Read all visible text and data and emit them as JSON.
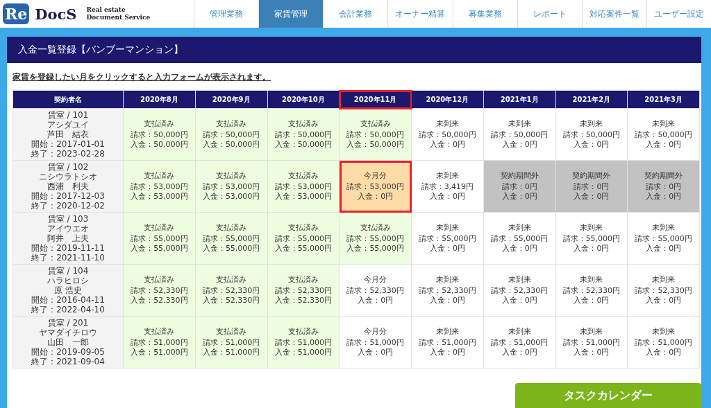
{
  "logo": {
    "mark": "Re",
    "name": "DocS",
    "tagline": [
      "Real estate",
      "Document Service"
    ]
  },
  "nav": [
    {
      "label": "管理業務",
      "selected": false
    },
    {
      "label": "家賃管理",
      "selected": true
    },
    {
      "label": "会計業務",
      "selected": false
    },
    {
      "label": "オーナー精算",
      "selected": false
    },
    {
      "label": "募集業務",
      "selected": false
    },
    {
      "label": "レポート",
      "selected": false
    },
    {
      "label": "対応案件一覧",
      "selected": false
    },
    {
      "label": "ユーザー設定",
      "selected": false
    }
  ],
  "page_title": "入金一覧登録【バンブーマンション】",
  "instruction": "家賃を登録したい月をクリックすると入力フォームが表示されます。",
  "table": {
    "name_column": "契約者名",
    "columns": [
      {
        "label": "2020年8月",
        "highlighted": false
      },
      {
        "label": "2020年9月",
        "highlighted": false
      },
      {
        "label": "2020年10月",
        "highlighted": false
      },
      {
        "label": "2020年11月",
        "highlighted": true
      },
      {
        "label": "2020年12月",
        "highlighted": false
      },
      {
        "label": "2021年1月",
        "highlighted": false
      },
      {
        "label": "2021年2月",
        "highlighted": false
      },
      {
        "label": "2021年3月",
        "highlighted": false
      }
    ],
    "rows": [
      {
        "tenant": [
          "賃室 / 101",
          "アシダユイ",
          "芦田　結衣",
          "開始：2017-01-01",
          "終了：2023-02-28"
        ],
        "cells": [
          {
            "kind": "paid",
            "status": "支払済み",
            "billed": "請求：50,000円",
            "received": "入金：50,000円",
            "highlighted": false
          },
          {
            "kind": "paid",
            "status": "支払済み",
            "billed": "請求：50,000円",
            "received": "入金：50,000円",
            "highlighted": false
          },
          {
            "kind": "paid",
            "status": "支払済み",
            "billed": "請求：50,000円",
            "received": "入金：50,000円",
            "highlighted": false
          },
          {
            "kind": "paid",
            "status": "支払済み",
            "billed": "請求：50,000円",
            "received": "入金：50,000円",
            "highlighted": false
          },
          {
            "kind": "future",
            "status": "未到来",
            "billed": "請求：50,000円",
            "received": "入金：0円",
            "highlighted": false
          },
          {
            "kind": "future",
            "status": "未到来",
            "billed": "請求：50,000円",
            "received": "入金：0円",
            "highlighted": false
          },
          {
            "kind": "future",
            "status": "未到来",
            "billed": "請求：50,000円",
            "received": "入金：0円",
            "highlighted": false
          },
          {
            "kind": "future",
            "status": "未到来",
            "billed": "請求：50,000円",
            "received": "入金：0円",
            "highlighted": false
          }
        ]
      },
      {
        "tenant": [
          "賃室 / 102",
          "ニシウラトシオ",
          "西浦　利夫",
          "開始：2017-12-03",
          "終了：2020-12-02"
        ],
        "cells": [
          {
            "kind": "paid",
            "status": "支払済み",
            "billed": "請求：53,000円",
            "received": "入金：53,000円",
            "highlighted": false
          },
          {
            "kind": "paid",
            "status": "支払済み",
            "billed": "請求：53,000円",
            "received": "入金：53,000円",
            "highlighted": false
          },
          {
            "kind": "paid",
            "status": "支払済み",
            "billed": "請求：53,000円",
            "received": "入金：53,000円",
            "highlighted": false
          },
          {
            "kind": "current_due",
            "status": "今月分",
            "billed": "請求：53,000円",
            "received": "入金：0円",
            "highlighted": true
          },
          {
            "kind": "future",
            "status": "未到来",
            "billed": "請求：3,419円",
            "received": "入金：0円",
            "highlighted": false
          },
          {
            "kind": "out_of_term",
            "status": "契約期間外",
            "billed": "請求：0円",
            "received": "入金：0円",
            "highlighted": false
          },
          {
            "kind": "out_of_term",
            "status": "契約期間外",
            "billed": "請求：0円",
            "received": "入金：0円",
            "highlighted": false
          },
          {
            "kind": "out_of_term",
            "status": "契約期間外",
            "billed": "請求：0円",
            "received": "入金：0円",
            "highlighted": false
          }
        ]
      },
      {
        "tenant": [
          "賃室 / 103",
          "アイウエオ",
          "阿井　上夫",
          "開始：2019-11-11",
          "終了：2021-11-10"
        ],
        "cells": [
          {
            "kind": "paid",
            "status": "支払済み",
            "billed": "請求：55,000円",
            "received": "入金：55,000円",
            "highlighted": false
          },
          {
            "kind": "paid",
            "status": "支払済み",
            "billed": "請求：55,000円",
            "received": "入金：55,000円",
            "highlighted": false
          },
          {
            "kind": "paid",
            "status": "支払済み",
            "billed": "請求：55,000円",
            "received": "入金：55,000円",
            "highlighted": false
          },
          {
            "kind": "paid",
            "status": "支払済み",
            "billed": "請求：55,000円",
            "received": "入金：55,000円",
            "highlighted": false
          },
          {
            "kind": "future",
            "status": "未到来",
            "billed": "請求：55,000円",
            "received": "入金：0円",
            "highlighted": false
          },
          {
            "kind": "future",
            "status": "未到来",
            "billed": "請求：55,000円",
            "received": "入金：0円",
            "highlighted": false
          },
          {
            "kind": "future",
            "status": "未到来",
            "billed": "請求：55,000円",
            "received": "入金：0円",
            "highlighted": false
          },
          {
            "kind": "future",
            "status": "未到来",
            "billed": "請求：55,000円",
            "received": "入金：0円",
            "highlighted": false
          }
        ]
      },
      {
        "tenant": [
          "賃室 / 104",
          "ハラヒロシ",
          "原 浩史",
          "開始：2016-04-11",
          "終了：2022-04-10"
        ],
        "cells": [
          {
            "kind": "paid",
            "status": "支払済み",
            "billed": "請求：52,330円",
            "received": "入金：52,330円",
            "highlighted": false
          },
          {
            "kind": "paid",
            "status": "支払済み",
            "billed": "請求：52,330円",
            "received": "入金：52,330円",
            "highlighted": false
          },
          {
            "kind": "paid",
            "status": "支払済み",
            "billed": "請求：52,330円",
            "received": "入金：52,330円",
            "highlighted": false
          },
          {
            "kind": "current",
            "status": "今月分",
            "billed": "請求：52,330円",
            "received": "入金：0円",
            "highlighted": false
          },
          {
            "kind": "future",
            "status": "未到来",
            "billed": "請求：52,330円",
            "received": "入金：0円",
            "highlighted": false
          },
          {
            "kind": "future",
            "status": "未到来",
            "billed": "請求：52,330円",
            "received": "入金：0円",
            "highlighted": false
          },
          {
            "kind": "future",
            "status": "未到来",
            "billed": "請求：52,330円",
            "received": "入金：0円",
            "highlighted": false
          },
          {
            "kind": "future",
            "status": "未到来",
            "billed": "請求：52,330円",
            "received": "入金：0円",
            "highlighted": false
          }
        ]
      },
      {
        "tenant": [
          "賃室 / 201",
          "ヤマダイチロウ",
          "山田　一郎",
          "開始：2019-09-05",
          "終了：2021-09-04"
        ],
        "cells": [
          {
            "kind": "paid",
            "status": "支払済み",
            "billed": "請求：51,000円",
            "received": "入金：51,000円",
            "highlighted": false
          },
          {
            "kind": "paid",
            "status": "支払済み",
            "billed": "請求：51,000円",
            "received": "入金：51,000円",
            "highlighted": false
          },
          {
            "kind": "paid",
            "status": "支払済み",
            "billed": "請求：51,000円",
            "received": "入金：51,000円",
            "highlighted": false
          },
          {
            "kind": "current",
            "status": "今月分",
            "billed": "請求：51,000円",
            "received": "入金：0円",
            "highlighted": false
          },
          {
            "kind": "future",
            "status": "未到来",
            "billed": "請求：51,000円",
            "received": "入金：0円",
            "highlighted": false
          },
          {
            "kind": "future",
            "status": "未到来",
            "billed": "請求：51,000円",
            "received": "入金：0円",
            "highlighted": false
          },
          {
            "kind": "future",
            "status": "未到来",
            "billed": "請求：51,000円",
            "received": "入金：0円",
            "highlighted": false
          },
          {
            "kind": "future",
            "status": "未到来",
            "billed": "請求：51,000円",
            "received": "入金：0円",
            "highlighted": false
          }
        ]
      }
    ]
  },
  "task_calendar_button": "タスクカレンダー"
}
